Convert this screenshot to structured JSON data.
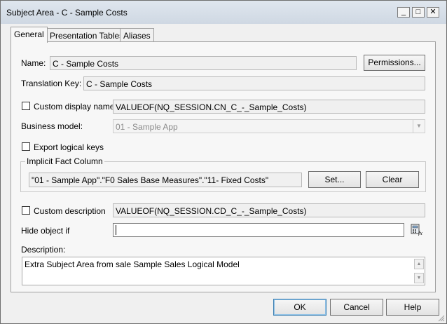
{
  "window": {
    "title": "Subject Area - C - Sample Costs",
    "minimize_glyph": "_",
    "maximize_glyph": "□",
    "close_glyph": "✕"
  },
  "tabs": [
    {
      "label": "General"
    },
    {
      "label": "Presentation Tables"
    },
    {
      "label": "Aliases"
    }
  ],
  "general": {
    "name_label": "Name:",
    "name_value": "C - Sample Costs",
    "permissions_label": "Permissions...",
    "translation_key_label": "Translation Key:",
    "translation_key_value": "C - Sample Costs",
    "custom_display_name_label": "Custom display name",
    "custom_display_name_value": "VALUEOF(NQ_SESSION.CN_C_-_Sample_Costs)",
    "business_model_label": "Business model:",
    "business_model_value": "01 - Sample App",
    "export_logical_keys_label": "Export logical keys",
    "implicit_fact_column_label": "Implicit Fact Column",
    "implicit_fact_column_value": "\"01 - Sample App\".\"F0 Sales Base Measures\".\"11- Fixed Costs\"",
    "set_label": "Set...",
    "clear_label": "Clear",
    "custom_description_label": "Custom description",
    "custom_description_value": "VALUEOF(NQ_SESSION.CD_C_-_Sample_Costs)",
    "hide_object_if_label": "Hide object if",
    "hide_object_if_value": "",
    "description_label": "Description:",
    "description_value": "Extra Subject Area from sale Sample Sales Logical Model"
  },
  "footer": {
    "ok_label": "OK",
    "cancel_label": "Cancel",
    "help_label": "Help"
  }
}
